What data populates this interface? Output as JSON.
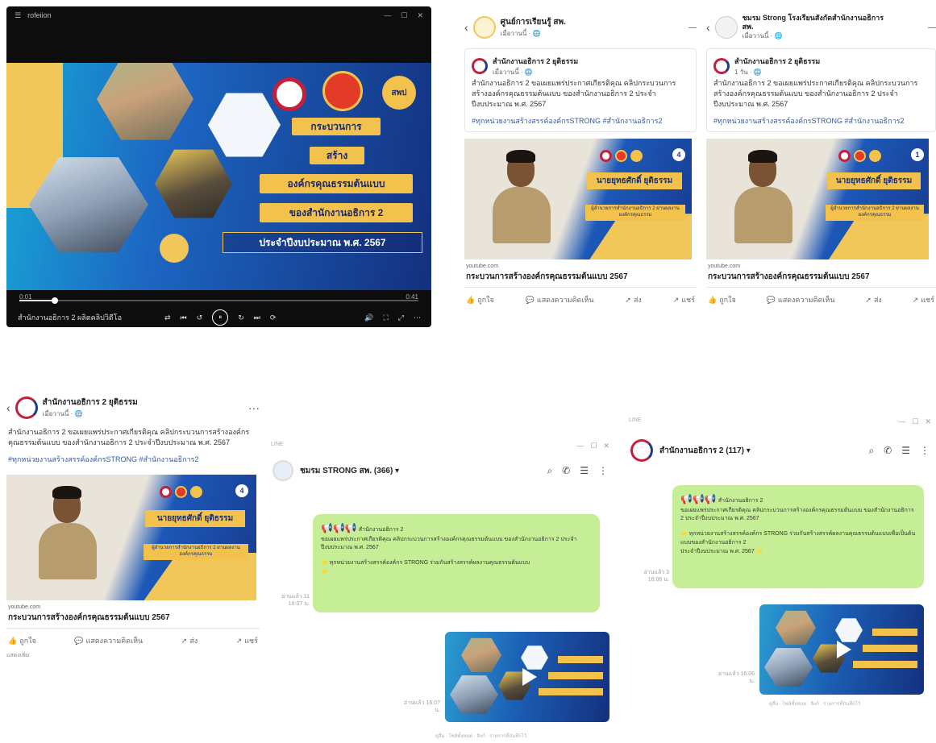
{
  "player": {
    "title": "rofeiion",
    "window_controls": [
      "—",
      "☐",
      "✕"
    ],
    "logo_labels": [
      "",
      "",
      "สพป"
    ],
    "banners": [
      "กระบวนการ",
      "สร้าง",
      "องค์กรคุณธรรมต้นแบบ",
      "ของสำนักงานอธิการ 2",
      "ประจำปีงบประมาณ พ.ศ. 2567"
    ],
    "time_start": "0:01",
    "time_end": "0:41",
    "caption": "สำนักงานอธิการ 2 ผลิตคลิปวิดีโอ",
    "controls": [
      "⇄",
      "⏮",
      "↺",
      "⏸",
      "↻",
      "⏭",
      "⟳"
    ],
    "right_controls": [
      "🔊",
      "⛶",
      "⤢",
      "⋯"
    ]
  },
  "fb_top_left": {
    "header_name": "ศูนย์การเรียนรู้ สพ.",
    "header_sub": "เมื่อวานนี้ · 🌐",
    "more_label": "—",
    "inner_name": "สำนักงานอธิการ 2 ยุติธรรม",
    "inner_sub": "เมื่อวานนี้ · 🌐",
    "text": "สำนักงานอธิการ 2 ขอเผยแพร่ประกาศเกียรติคุณ คลิปกระบวนการสร้างองค์กรคุณธรรมต้นแบบ ของสำนักงานอธิการ 2 ประจำปีงบประมาณ พ.ศ. 2567",
    "hashtags": "#ทุกหน่วยงานสร้างสรรค์องค์กรSTRONG #สำนักงานอธิการ2",
    "person_name": "นายยุทธศักดิ์ ยุติธรรม",
    "role": "ผู้อำนวยการสำนักงานอธิการ 2 ผ่านผลงานองค์กรคุณธรรม",
    "badge": "4",
    "domain": "youtube.com",
    "link_title": "กระบวนการสร้างองค์กรคุณธรรมต้นแบบ 2567",
    "actions": [
      "ถูกใจ",
      "แสดงความคิดเห็น",
      "ส่ง",
      "แชร์"
    ]
  },
  "fb_top_right": {
    "header_name": "ชมรม Strong โรงเรียนสังกัดสำนักงานอธิการ สพ.",
    "header_sub": "เมื่อวานนี้ · 🌐",
    "more_label": "—",
    "inner_name": "สำนักงานอธิการ 2 ยุติธรรม",
    "inner_sub": "1 วัน · 🌐",
    "text": "สำนักงานอธิการ 2 ขอเผยแพร่ประกาศเกียรติคุณ คลิปกระบวนการสร้างองค์กรคุณธรรมต้นแบบ ของสำนักงานอธิการ 2 ประจำปีงบประมาณ พ.ศ. 2567",
    "hashtags": "#ทุกหน่วยงานสร้างสรรค์องค์กรSTRONG #สำนักงานอธิการ2",
    "person_name": "นายยุทธศักดิ์ ยุติธรรม",
    "role": "ผู้อำนวยการสำนักงานอธิการ 2 ผ่านผลงานองค์กรคุณธรรม",
    "badge": "1",
    "domain": "youtube.com",
    "link_title": "กระบวนการสร้างองค์กรคุณธรรมต้นแบบ 2567",
    "actions": [
      "ถูกใจ",
      "แสดงความคิดเห็น",
      "ส่ง",
      "แชร์"
    ]
  },
  "fb_bottom": {
    "header_name": "สำนักงานอธิการ 2 ยุติธรรม",
    "header_sub": "เมื่อวานนี้ · 🌐",
    "more_label": "···",
    "text": "สำนักงานอธิการ 2 ขอเผยแพร่ประกาศเกียรติคุณ คลิปกระบวนการสร้างองค์กรคุณธรรมต้นแบบ ของสำนักงานอธิการ 2 ประจำปีงบประมาณ พ.ศ. 2567",
    "hashtags": "#ทุกหน่วยงานสร้างสรรค์องค์กรSTRONG #สำนักงานอธิการ2",
    "person_name": "นายยุทธศักดิ์ ยุติธรรม",
    "role": "ผู้อำนวยการสำนักงานอธิการ 2 ผ่านผลงานองค์กรคุณธรรม",
    "badge": "4",
    "domain": "youtube.com",
    "link_title": "กระบวนการสร้างองค์กรคุณธรรมต้นแบบ 2567",
    "actions": [
      "ถูกใจ",
      "แสดงความคิดเห็น",
      "ส่ง",
      "แชร์"
    ],
    "footer": "แสดงเพิ่ม"
  },
  "line_mid": {
    "window_label": "LINE",
    "window_controls": [
      "—",
      "☐",
      "✕"
    ],
    "title": "ชมรม STRONG สพ. (366) ▾",
    "icons": [
      "⌕",
      "✆",
      "☰",
      "⋮"
    ],
    "bubble_header": "📢📢📢",
    "bubble_sender": "สำนักงานอธิการ 2",
    "bubble_text": "ขอเผยแพร่ประกาศเกียรติคุณ คลิปกระบวนการสร้างองค์กรคุณธรรมต้นแบบ ของสำนักงานอธิการ 2 ประจำปีงบประมาณ พ.ศ. 2567",
    "bubble_text2": "⭐ ทุกหน่วยงานสร้างสรรค์องค์กร STRONG ร่วมกันสร้างสรรค์ผลงานคุณธรรมต้นแบบ",
    "bubble_text3": "⭐",
    "read_label": "อ่านแล้ว 11 16:07 น.",
    "video_read": "อ่านแล้ว 16:07 น.",
    "footer": "ดูสื่อ · ไฟล์ทั้งหมด · ลิงก์ · รายการที่บันทึกไว้"
  },
  "line_right": {
    "window_label": "LINE",
    "window_controls": [
      "—",
      "☐",
      "✕"
    ],
    "title": "สำนักงานอธิการ 2 (117) ▾",
    "icons": [
      "⌕",
      "✆",
      "☰",
      "⋮"
    ],
    "bubble_header": "📢📢📢",
    "bubble_sender": "สำนักงานอธิการ 2",
    "bubble_text": "ขอเผยแพร่ประกาศเกียรติคุณ คลิปกระบวนการสร้างองค์กรคุณธรรมต้นแบบ ของสำนักงานอธิการ 2 ประจำปีงบประมาณ พ.ศ. 2567",
    "bubble_text2": "⭐ ทุกหน่วยงานสร้างสรรค์องค์กร STRONG ร่วมกันสร้างสรรค์ผลงานคุณธรรมต้นแบบเพื่อเป็นต้นแบบของสำนักงานอธิการ 2",
    "bubble_text3": "ประจำปีงบประมาณ พ.ศ. 2567 ⭐",
    "read_label": "อ่านแล้ว 3 16:06 น.",
    "video_read": "อ่านแล้ว 16:06 น.",
    "footer": "ดูสื่อ · ไฟล์ทั้งหมด · ลิงก์ · รายการที่บันทึกไว้"
  },
  "colors": {
    "brand_blue": "#1d58b8",
    "gold": "#f3c24c",
    "line_bubble": "#c6ee97",
    "fb_link": "#385898"
  }
}
